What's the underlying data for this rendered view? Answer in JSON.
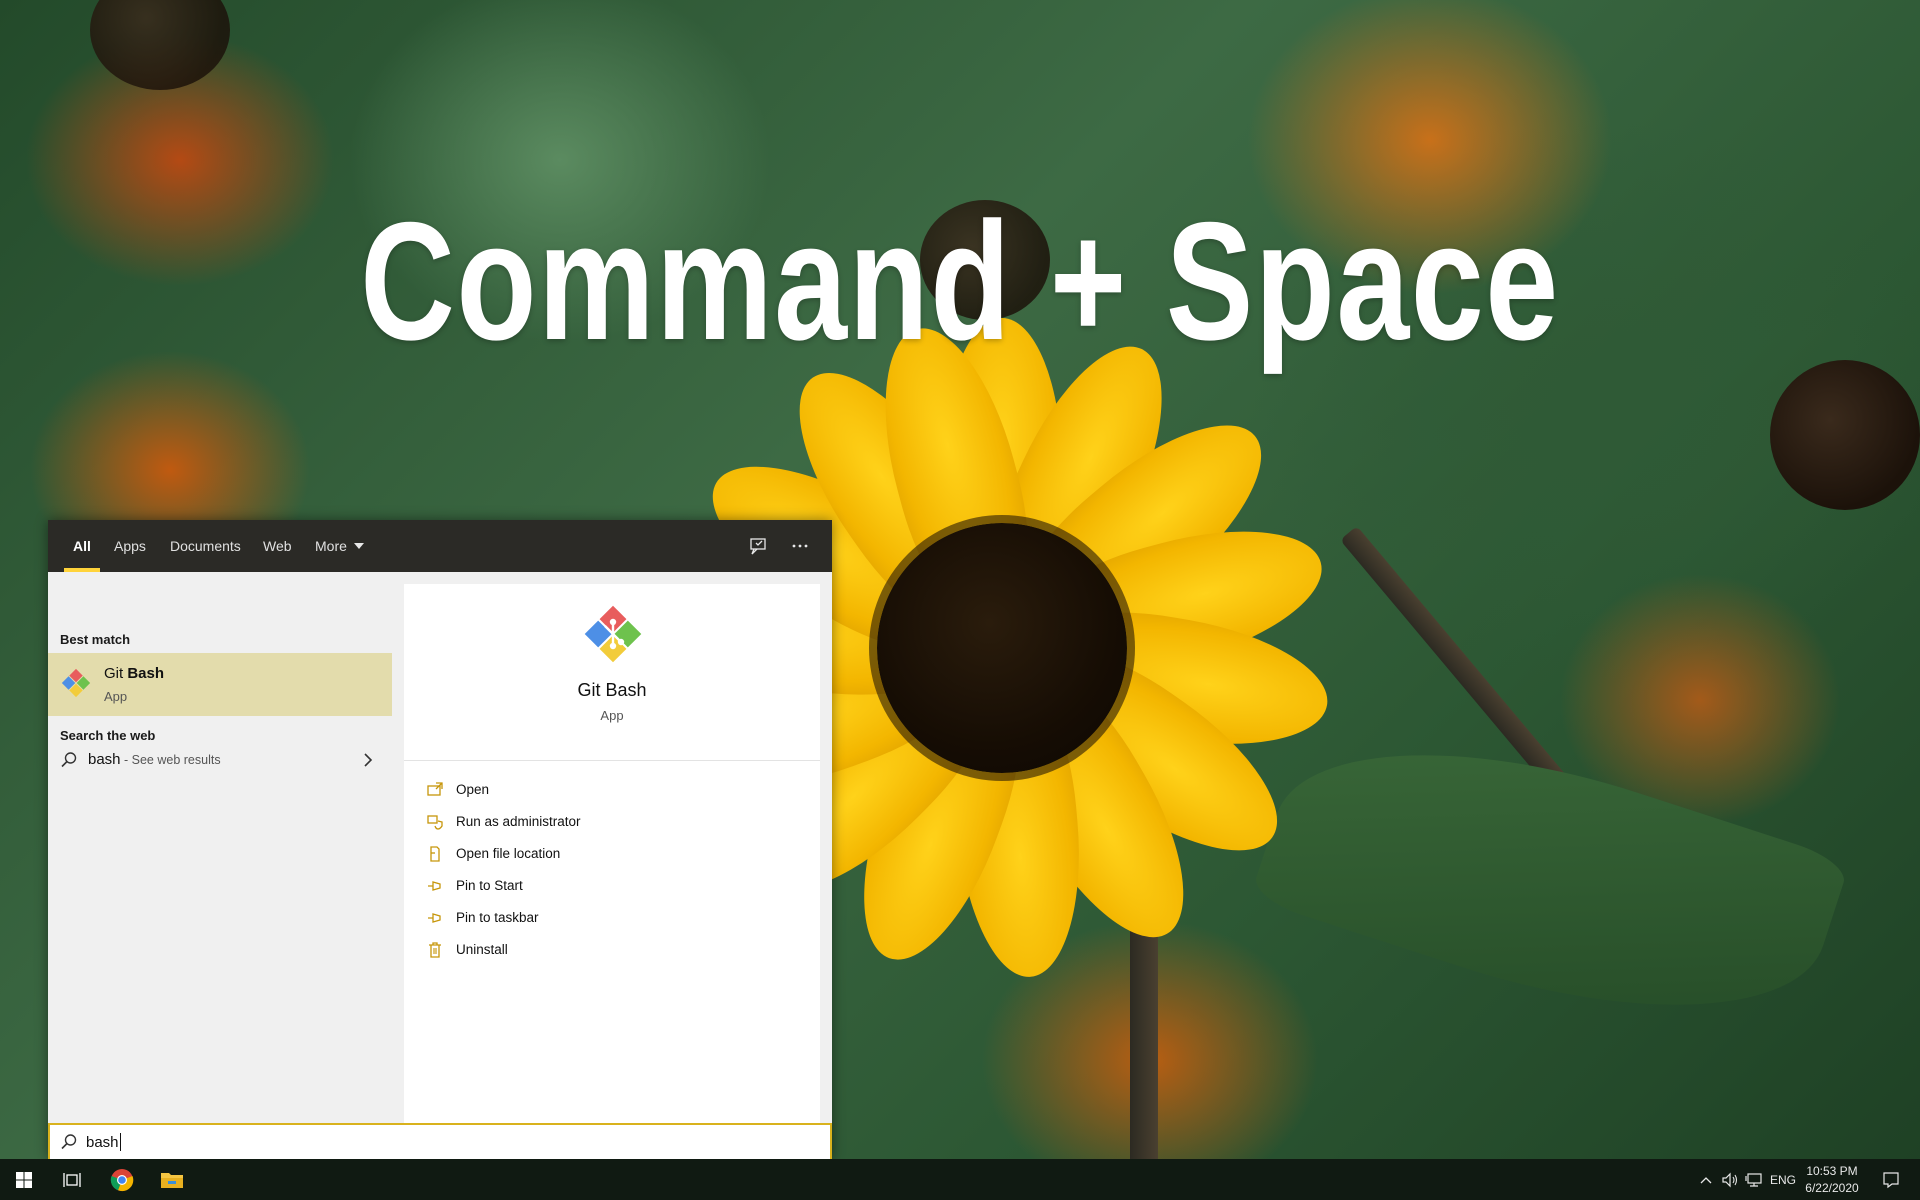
{
  "overlay": {
    "title": "Command + Space"
  },
  "search_panel": {
    "tabs": [
      {
        "label": "All",
        "active": true
      },
      {
        "label": "Apps",
        "active": false
      },
      {
        "label": "Documents",
        "active": false
      },
      {
        "label": "Web",
        "active": false
      },
      {
        "label": "More",
        "active": false
      }
    ],
    "header_icons": [
      "feedback-icon",
      "more-options-icon"
    ],
    "best_match": {
      "section_label": "Best match",
      "name_prefix": "Git ",
      "name_highlight": "Bash",
      "type": "App"
    },
    "search_web": {
      "section_label": "Search the web",
      "term": "bash",
      "suffix": " - See web results"
    },
    "details": {
      "name": "Git Bash",
      "type": "App",
      "actions": [
        {
          "label": "Open",
          "icon": "open-icon"
        },
        {
          "label": "Run as administrator",
          "icon": "shield-icon"
        },
        {
          "label": "Open file location",
          "icon": "file-location-icon"
        },
        {
          "label": "Pin to Start",
          "icon": "pin-icon"
        },
        {
          "label": "Pin to taskbar",
          "icon": "pin-icon"
        },
        {
          "label": "Uninstall",
          "icon": "trash-icon"
        }
      ]
    },
    "search_box": {
      "value": "bash"
    }
  },
  "taskbar": {
    "apps": [
      "start-icon",
      "task-view-icon",
      "chrome-icon",
      "file-explorer-icon"
    ],
    "tray": {
      "language": "ENG",
      "time": "10:53 PM",
      "date": "6/22/2020"
    }
  },
  "colors": {
    "accent": "#ffd33a",
    "selection": "#e3dcac",
    "search_border": "#d9b21d",
    "header_bg": "#2b2a26",
    "taskbar_bg": "#101a12"
  }
}
